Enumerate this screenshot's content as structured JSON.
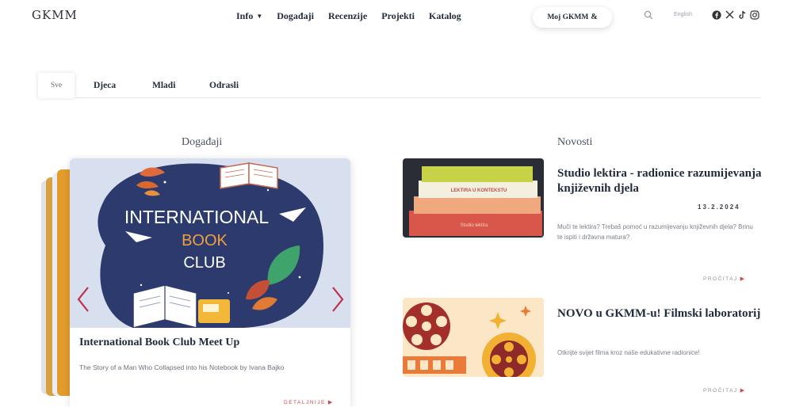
{
  "header": {
    "logo": "GKMM",
    "nav": [
      {
        "label": "Info",
        "has_dropdown": true
      },
      {
        "label": "Događaji"
      },
      {
        "label": "Recenzije"
      },
      {
        "label": "Projekti"
      },
      {
        "label": "Katalog"
      }
    ],
    "my_account_label": "Moj GKMM",
    "language": "English",
    "icons": [
      "search-icon",
      "facebook-icon",
      "x-icon",
      "tiktok-icon",
      "instagram-icon"
    ]
  },
  "tabs": [
    {
      "label": "Sve",
      "active": true
    },
    {
      "label": "Djeca"
    },
    {
      "label": "Mladi"
    },
    {
      "label": "Odrasli"
    }
  ],
  "events": {
    "heading": "Događaji",
    "card": {
      "image_text": [
        "INTERNATIONAL",
        "BOOK",
        "CLUB"
      ],
      "title": "International Book Club Meet Up",
      "text": "The Story of a Man Who Collapsed into his Notebook by Ivana Bajko",
      "more": "DETALJNIJE"
    }
  },
  "news": {
    "heading": "Novosti",
    "items": [
      {
        "image_text": [
          "LEKTIRA U KONTEKSTU",
          "Studio lektira"
        ],
        "title": "Studio lektira - radionice razumijevanja književnih djela",
        "date": "13.2.2024",
        "text": "Muči te lektira? Trebaš pomoć u razumijevanju književnih djela? Brinu te ispiti i državna matura?",
        "more": "PROČITAJ"
      },
      {
        "title": "NOVO u GKMM-u! Filmski laboratorij",
        "text": "Otkrijte svijet filma kroz naše edukativne radionice!",
        "more": "PROČITAJ"
      }
    ]
  },
  "colors": {
    "accent_red": "#d04a4a",
    "navy": "#1f2a3a",
    "card_bg_blue": "#2d3a6e",
    "orange": "#e39c2c"
  }
}
